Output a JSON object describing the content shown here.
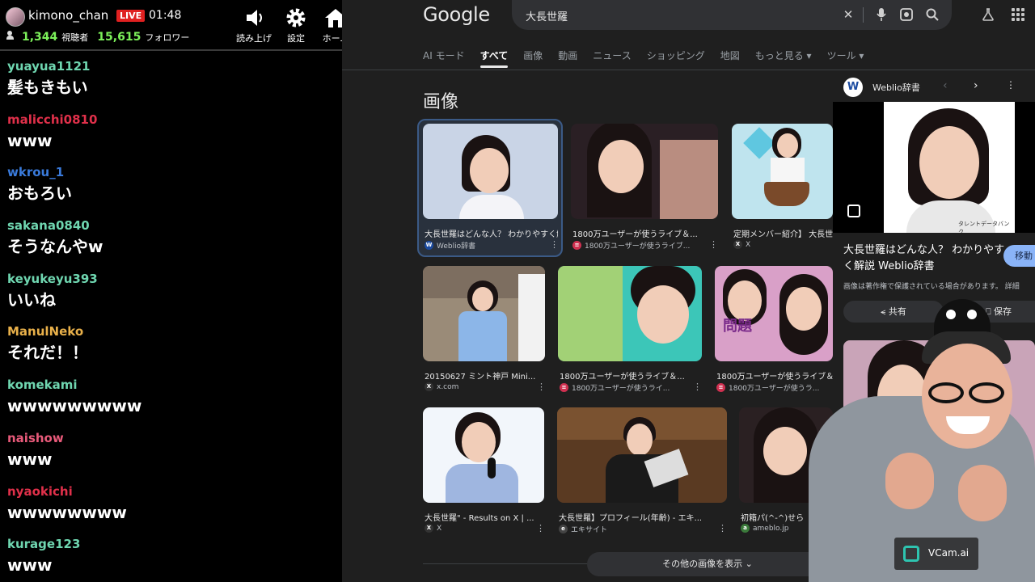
{
  "live": {
    "streamer": "kimono_chan",
    "live_badge": "LIVE",
    "elapsed": "01:48",
    "viewers": "1,344",
    "viewers_label": "視聴者",
    "followers": "15,615",
    "followers_label": "フォロワー",
    "buttons": [
      {
        "label": "読み上げ",
        "icon": "speaker-icon"
      },
      {
        "label": "設定",
        "icon": "gear-icon"
      },
      {
        "label": "ホーム",
        "icon": "home-icon"
      }
    ],
    "chat": [
      {
        "user": "yuayua1121",
        "color": "#6fd6b0",
        "text": "髪もきもい"
      },
      {
        "user": "malicchi0810",
        "color": "#e0304a",
        "text": "www"
      },
      {
        "user": "wkrou_1",
        "color": "#3a7bdc",
        "text": "おもろい"
      },
      {
        "user": "sakana0840",
        "color": "#6fd6b0",
        "text": "そうなんやw"
      },
      {
        "user": "keyukeyu393",
        "color": "#6fd6b0",
        "text": "いいね"
      },
      {
        "user": "ManulNeko",
        "color": "#e8b04a",
        "text": "それだ！！"
      },
      {
        "user": "komekami",
        "color": "#6fd6b0",
        "text": "wwwwwwwww"
      },
      {
        "user": "naishow",
        "color": "#e85a7a",
        "text": "www"
      },
      {
        "user": "nyaokichi",
        "color": "#e0304a",
        "text": "wwwwwwww"
      },
      {
        "user": "kurage123",
        "color": "#6fd6b0",
        "text": "www"
      }
    ]
  },
  "google": {
    "logo": "Google",
    "query": "大長世羅",
    "tabs": [
      {
        "label": "AI モード",
        "active": false
      },
      {
        "label": "すべて",
        "active": true
      },
      {
        "label": "画像",
        "active": false
      },
      {
        "label": "動画",
        "active": false
      },
      {
        "label": "ニュース",
        "active": false
      },
      {
        "label": "ショッピング",
        "active": false
      },
      {
        "label": "地図",
        "active": false
      },
      {
        "label": "もっと見る ▾",
        "active": false
      },
      {
        "label": "ツール ▾",
        "active": false
      }
    ],
    "section_title": "画像",
    "images": [
      {
        "caption": "大長世羅はどんな人？ わかりやすく解説 Weblio辞書",
        "source": "Weblio辞書",
        "fav": "W",
        "fav_color": "#1a4aa0"
      },
      {
        "caption": "1800万ユーザーが使うライブ＆...",
        "source": "1800万ユーザーが使うライブ...",
        "fav": "≡",
        "fav_color": "#d03050"
      },
      {
        "caption": "定期メンバー紹介】 大長世羅",
        "source": "X",
        "fav": "X",
        "fav_color": "#333333"
      },
      {
        "caption": "20150627 ミント神戸 Mini...",
        "source": "x.com",
        "fav": "X",
        "fav_color": "#333333"
      },
      {
        "caption": "1800万ユーザーが使うライブ＆...",
        "source": "1800万ユーザーが使うライ...",
        "fav": "≡",
        "fav_color": "#d03050"
      },
      {
        "caption": "1800万ユーザーが使うライブ＆...",
        "source": "1800万ユーザーが使うラ...",
        "fav": "≡",
        "fav_color": "#d03050"
      },
      {
        "caption": "大長世羅\" - Results on X | ...",
        "source": "X",
        "fav": "X",
        "fav_color": "#333333"
      },
      {
        "caption": "大長世羅】プロフィール(年齢) - エキ...",
        "source": "エキサイト",
        "fav": "e",
        "fav_color": "#444444"
      },
      {
        "caption": "初箱パ(^-^)せら",
        "source": "ameblo.jp",
        "fav": "a",
        "fav_color": "#3b7a3b"
      }
    ],
    "more_images": "その他の画像を表示 ⌄",
    "side_panel": {
      "site": "Weblio辞書",
      "logo_letter": "W",
      "title": "大長世羅はどんな人？ わかりやすく解説 Weblio辞書",
      "visit": "移動",
      "copyright": "画像は著作権で保護されている場合があります。 詳細",
      "share": "共有",
      "save": "保存",
      "watermark": "タレントデータバンク"
    }
  },
  "overlay": {
    "vcam": "VCam.ai"
  }
}
